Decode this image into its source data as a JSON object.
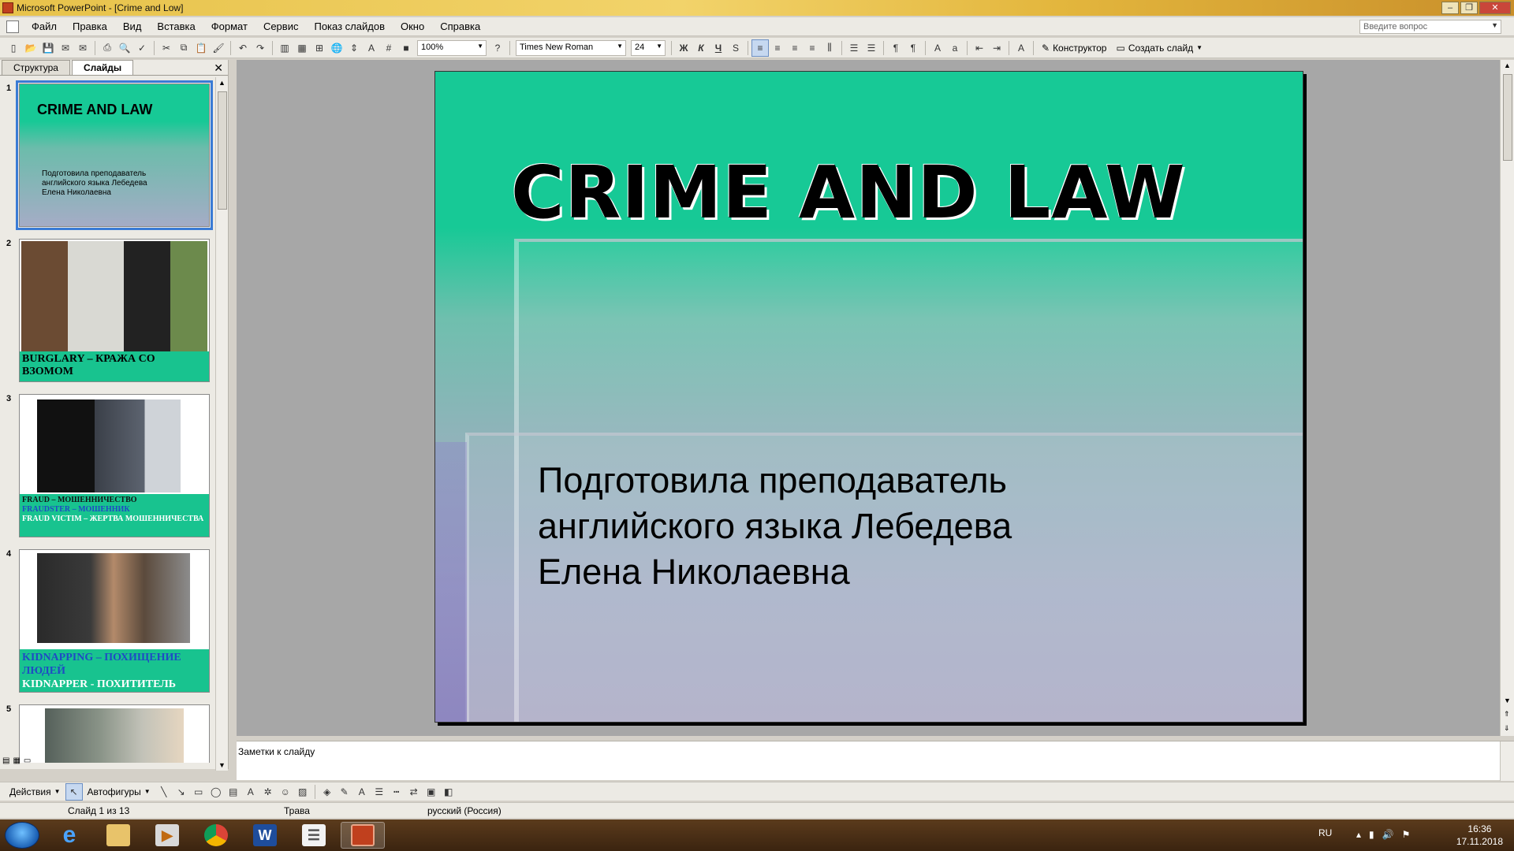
{
  "window": {
    "title": "Microsoft PowerPoint - [Crime and Low]"
  },
  "menu": {
    "items": [
      "Файл",
      "Правка",
      "Вид",
      "Вставка",
      "Формат",
      "Сервис",
      "Показ слайдов",
      "Окно",
      "Справка"
    ],
    "ask_placeholder": "Введите вопрос"
  },
  "toolbar": {
    "zoom": "100%",
    "font": "Times New Roman",
    "font_size": "24",
    "bold": "Ж",
    "italic": "К",
    "underline": "Ч",
    "shadow": "S",
    "designer_label": "Конструктор",
    "new_slide_label": "Создать слайд"
  },
  "left_panel": {
    "tabs": [
      "Структура",
      "Слайды"
    ],
    "active_tab": "Слайды",
    "thumbnails": [
      {
        "num": "1",
        "title": "CRIME AND LAW",
        "subtitle": "Подготовила преподаватель английского языка Лебедева Елена Николаевна"
      },
      {
        "num": "2",
        "caption": "BURGLARY – КРАЖА СО ВЗОМОМ"
      },
      {
        "num": "3",
        "caption_lines": [
          "FRAUD – МОШЕННИЧЕСТВО",
          "FRAUDSTER – МОШЕННИК",
          "FRAUD VICTIM – ЖЕРТВА МОШЕННИЧЕСТВА"
        ]
      },
      {
        "num": "4",
        "caption_lines": [
          "KIDNAPPING – ПОХИЩЕНИЕ ЛЮДЕЙ",
          "KIDNAPPER - ПОХИТИТЕЛЬ"
        ]
      },
      {
        "num": "5"
      }
    ]
  },
  "slide": {
    "title": "CRIME AND LAW",
    "subtitle": "Подготовила преподаватель английского языка Лебедева Елена Николаевна"
  },
  "notes": {
    "placeholder": "Заметки к слайду"
  },
  "drawbar": {
    "actions": "Действия",
    "autoshapes": "Автофигуры"
  },
  "status": {
    "slide": "Слайд 1 из 13",
    "theme": "Трава",
    "language": "русский (Россия)"
  },
  "taskbar": {
    "lang": "RU",
    "time": "16:36",
    "date": "17.11.2018"
  }
}
